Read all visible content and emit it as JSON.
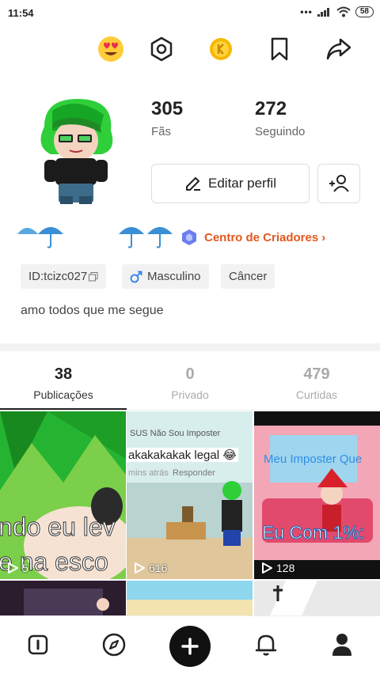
{
  "status_bar": {
    "time": "11:54",
    "battery": "58"
  },
  "stats": {
    "fans": {
      "value": "305",
      "label": "Fãs"
    },
    "following": {
      "value": "272",
      "label": "Seguindo"
    }
  },
  "actions": {
    "edit_profile": "Editar perfil"
  },
  "creators_link": "Centro de Criadores",
  "tags": {
    "id": "ID:tcizc027",
    "gender": "Masculino",
    "sign": "Câncer"
  },
  "bio": "amo todos que me segue",
  "tabs": [
    {
      "count": "38",
      "label": "Publicações"
    },
    {
      "count": "0",
      "label": "Privado"
    },
    {
      "count": "479",
      "label": "Curtidas"
    }
  ],
  "posts": [
    {
      "views": "5",
      "caption": "ndo eu lev",
      "caption2": "e na esco"
    },
    {
      "views": "616",
      "title": "SUS Não Sou Imposter",
      "comment": "akakakakak legal 😂",
      "meta": "mins atrás",
      "reply": "Responder"
    },
    {
      "views": "128",
      "title": "Meu Imposter Que",
      "caption": "Eu Com 1%:"
    }
  ],
  "colors": {
    "accent_orange": "#e4571d",
    "gender_blue": "#2f80ed"
  }
}
